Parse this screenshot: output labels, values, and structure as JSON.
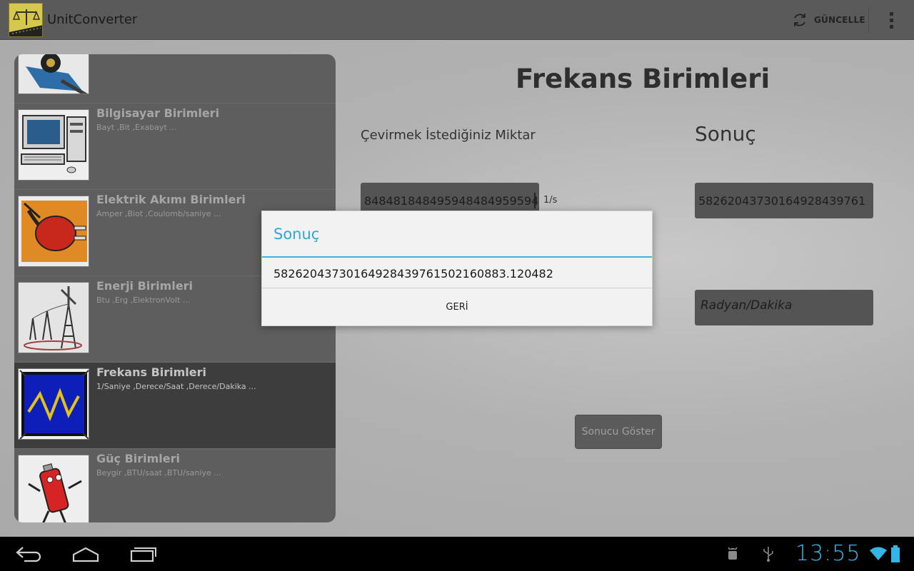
{
  "app": {
    "title": "UnitConverter"
  },
  "actionbar": {
    "refresh_label": "GÜNCELLE"
  },
  "categories": [
    {
      "name": "",
      "desc": ""
    },
    {
      "name": "Bilgisayar Birimleri",
      "desc": "Bayt ,Bit ,Exabayt ..."
    },
    {
      "name": "Elektrik Akımı Birimleri",
      "desc": "Amper ,Biot ,Coulomb/saniye ..."
    },
    {
      "name": "Enerji Birimleri",
      "desc": "Btu ,Erg ,ElektronVolt ..."
    },
    {
      "name": "Frekans Birimleri",
      "desc": "1/Saniye ,Derece/Saat ,Derece/Dakika ..."
    },
    {
      "name": "Güç Birimleri",
      "desc": "Beygir ,BTU/saat ,BTU/saniye ..."
    }
  ],
  "selected_category": "Frekans Birimleri",
  "form": {
    "title": "Frekans Birimleri",
    "input_label": "Çevirmek İstediğiniz Miktar",
    "result_label": "Sonuç",
    "input_value": "848481848495948484959594",
    "input_unit": "1/s",
    "result_value": "58262043730164928439761",
    "output_unit": "Radyan/Dakika",
    "show_button": "Sonucu Göster"
  },
  "dialog": {
    "title": "Sonuç",
    "message": "58262043730164928439761502160883.120482",
    "button": "GERİ"
  },
  "statusbar": {
    "time": "13:55"
  },
  "colors": {
    "accent": "#33b5e5",
    "dialog_title": "#2fa8d6",
    "clock": "#3bb9ea"
  }
}
